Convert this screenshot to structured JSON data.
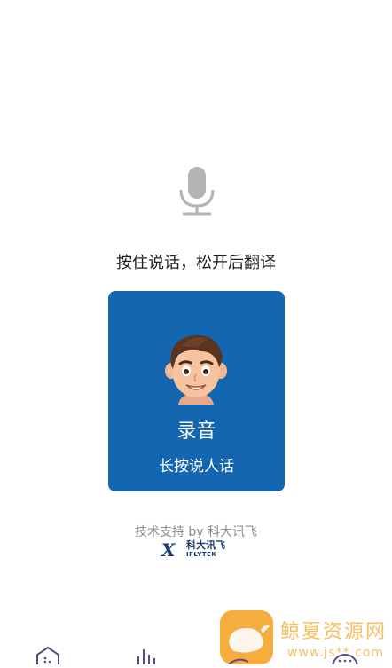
{
  "main": {
    "mic_icon": "microphone-icon",
    "instruction": "按住说话，松开后翻译",
    "record_card": {
      "avatar_icon": "boy-avatar",
      "title": "录音",
      "subtitle": "长按说人话"
    },
    "powered_by": "技术支持 by 科大讯飞",
    "brand": {
      "mark": "X",
      "cn": "科大讯飞",
      "en": "IFLYTEK"
    }
  },
  "watermark": {
    "text": "鲸夏资源网",
    "url": "www.js**.com"
  },
  "tabbar": {
    "tabs": [
      {
        "icon": "home-icon"
      },
      {
        "icon": "stats-icon"
      },
      {
        "icon": "center-icon"
      },
      {
        "icon": "more-icon"
      }
    ]
  },
  "colors": {
    "card": "#1466b0",
    "mic": "#b4b4b4",
    "watermark": "#f4a62a"
  }
}
